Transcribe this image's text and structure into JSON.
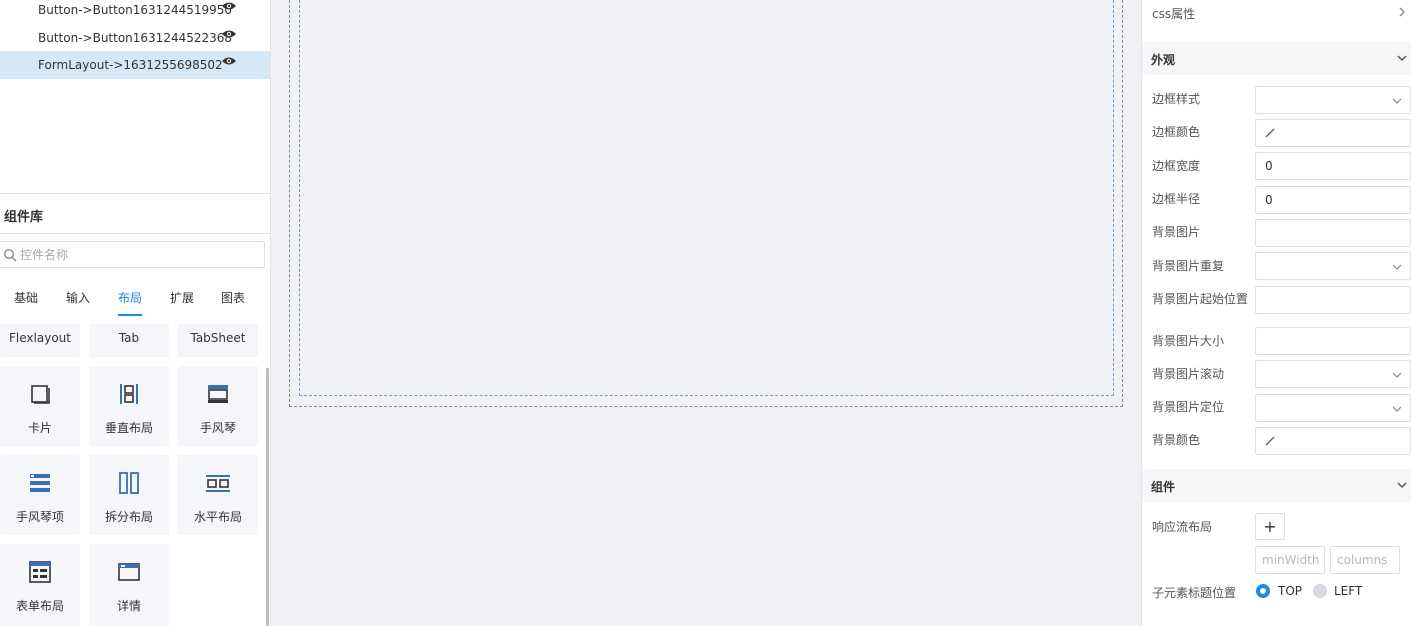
{
  "layer_tree": [
    {
      "label": "Button->Button1631244519950",
      "selected": false
    },
    {
      "label": "Button->Button1631244522368",
      "selected": false
    },
    {
      "label": "FormLayout->1631255698502",
      "selected": true
    }
  ],
  "library": {
    "title": "组件库",
    "search_placeholder": "控件名称",
    "tabs": [
      "基础",
      "输入",
      "布局",
      "扩展",
      "图表"
    ],
    "active_tab": "布局",
    "partial_items": [
      "Flexlayout",
      "Tab",
      "TabSheet"
    ],
    "items": [
      {
        "label": "卡片",
        "icon": "card-icon"
      },
      {
        "label": "垂直布局",
        "icon": "vertical-layout-icon"
      },
      {
        "label": "手风琴",
        "icon": "accordion-icon"
      },
      {
        "label": "手风琴项",
        "icon": "accordion-item-icon"
      },
      {
        "label": "拆分布局",
        "icon": "split-layout-icon"
      },
      {
        "label": "水平布局",
        "icon": "horizontal-layout-icon"
      },
      {
        "label": "表单布局",
        "icon": "form-layout-icon"
      },
      {
        "label": "详情",
        "icon": "details-icon"
      }
    ]
  },
  "properties": {
    "css_label": "css属性",
    "appearance": {
      "title": "外观",
      "fields": [
        {
          "label": "边框样式",
          "type": "select",
          "value": ""
        },
        {
          "label": "边框颜色",
          "type": "color",
          "value": ""
        },
        {
          "label": "边框宽度",
          "type": "text",
          "value": "0"
        },
        {
          "label": "边框半径",
          "type": "text",
          "value": "0"
        },
        {
          "label": "背景图片",
          "type": "text",
          "value": ""
        },
        {
          "label": "背景图片重复",
          "type": "select",
          "value": ""
        },
        {
          "label": "背景图片起始位置",
          "type": "text",
          "value": ""
        },
        {
          "label": "背景图片大小",
          "type": "text",
          "value": ""
        },
        {
          "label": "背景图片滚动",
          "type": "select",
          "value": ""
        },
        {
          "label": "背景图片定位",
          "type": "select",
          "value": ""
        },
        {
          "label": "背景颜色",
          "type": "color",
          "value": ""
        }
      ]
    },
    "component": {
      "title": "组件",
      "responsive_label": "响应流布局",
      "add_symbol": "+",
      "min_width_placeholder": "minWidth",
      "columns_placeholder": "columns",
      "title_position_label": "子元素标题位置",
      "title_position_options": [
        "TOP",
        "LEFT"
      ],
      "title_position_selected": "TOP"
    }
  },
  "colors": {
    "accent": "#1e88e5",
    "selected_row": "#d4e8f8",
    "canvas_bg": "#f0f0f5"
  }
}
